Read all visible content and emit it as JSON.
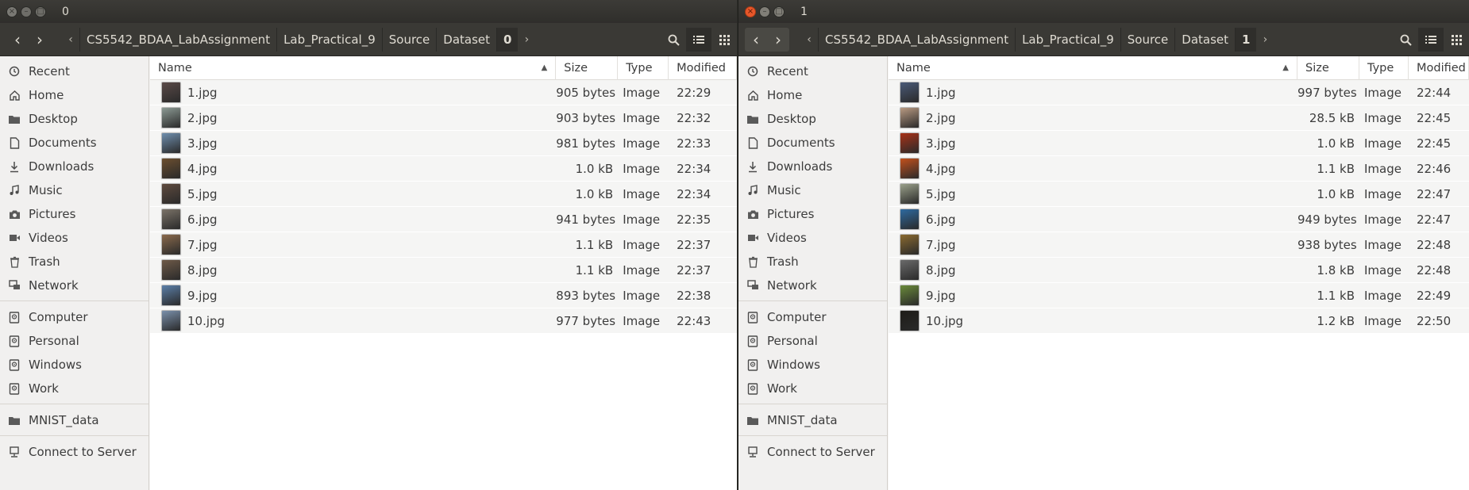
{
  "windows": [
    {
      "title": "0",
      "active": false,
      "breadcrumbs": [
        "CS5542_BDAA_LabAssignment",
        "Lab_Practical_9",
        "Source",
        "Dataset",
        "0"
      ],
      "columns": [
        "Name",
        "Size",
        "Type",
        "Modified"
      ],
      "files": [
        {
          "name": "1.jpg",
          "size": "905 bytes",
          "type": "Image",
          "modified": "22:29",
          "thumb": "#5a4a48"
        },
        {
          "name": "2.jpg",
          "size": "903 bytes",
          "type": "Image",
          "modified": "22:32",
          "thumb": "#8c9a94"
        },
        {
          "name": "3.jpg",
          "size": "981 bytes",
          "type": "Image",
          "modified": "22:33",
          "thumb": "#6f8fae"
        },
        {
          "name": "4.jpg",
          "size": "1.0 kB",
          "type": "Image",
          "modified": "22:34",
          "thumb": "#6b4e2f"
        },
        {
          "name": "5.jpg",
          "size": "1.0 kB",
          "type": "Image",
          "modified": "22:34",
          "thumb": "#5e4a3e"
        },
        {
          "name": "6.jpg",
          "size": "941 bytes",
          "type": "Image",
          "modified": "22:35",
          "thumb": "#7b7368"
        },
        {
          "name": "7.jpg",
          "size": "1.1 kB",
          "type": "Image",
          "modified": "22:37",
          "thumb": "#8a6a4c"
        },
        {
          "name": "8.jpg",
          "size": "1.1 kB",
          "type": "Image",
          "modified": "22:37",
          "thumb": "#6e5a48"
        },
        {
          "name": "9.jpg",
          "size": "893 bytes",
          "type": "Image",
          "modified": "22:38",
          "thumb": "#5b7fa8"
        },
        {
          "name": "10.jpg",
          "size": "977 bytes",
          "type": "Image",
          "modified": "22:43",
          "thumb": "#7a90ab"
        }
      ]
    },
    {
      "title": "1",
      "active": true,
      "breadcrumbs": [
        "CS5542_BDAA_LabAssignment",
        "Lab_Practical_9",
        "Source",
        "Dataset",
        "1"
      ],
      "columns": [
        "Name",
        "Size",
        "Type",
        "Modified"
      ],
      "files": [
        {
          "name": "1.jpg",
          "size": "997 bytes",
          "type": "Image",
          "modified": "22:44",
          "thumb": "#4a5a78"
        },
        {
          "name": "2.jpg",
          "size": "28.5 kB",
          "type": "Image",
          "modified": "22:45",
          "thumb": "#b89a82"
        },
        {
          "name": "3.jpg",
          "size": "1.0 kB",
          "type": "Image",
          "modified": "22:45",
          "thumb": "#a83218"
        },
        {
          "name": "4.jpg",
          "size": "1.1 kB",
          "type": "Image",
          "modified": "22:46",
          "thumb": "#c2501c"
        },
        {
          "name": "5.jpg",
          "size": "1.0 kB",
          "type": "Image",
          "modified": "22:47",
          "thumb": "#9aa08a"
        },
        {
          "name": "6.jpg",
          "size": "949 bytes",
          "type": "Image",
          "modified": "22:47",
          "thumb": "#2e6aa0"
        },
        {
          "name": "7.jpg",
          "size": "938 bytes",
          "type": "Image",
          "modified": "22:48",
          "thumb": "#8a6a30"
        },
        {
          "name": "8.jpg",
          "size": "1.8 kB",
          "type": "Image",
          "modified": "22:48",
          "thumb": "#6a6a6a"
        },
        {
          "name": "9.jpg",
          "size": "1.1 kB",
          "type": "Image",
          "modified": "22:49",
          "thumb": "#6a8a3a"
        },
        {
          "name": "10.jpg",
          "size": "1.2 kB",
          "type": "Image",
          "modified": "22:50",
          "thumb": "#1e1c18"
        }
      ]
    }
  ],
  "sidebar": {
    "places": [
      {
        "label": "Recent",
        "icon": "clock-icon"
      },
      {
        "label": "Home",
        "icon": "home-icon"
      },
      {
        "label": "Desktop",
        "icon": "folder-icon"
      },
      {
        "label": "Documents",
        "icon": "document-icon"
      },
      {
        "label": "Downloads",
        "icon": "download-icon"
      },
      {
        "label": "Music",
        "icon": "music-icon"
      },
      {
        "label": "Pictures",
        "icon": "camera-icon"
      },
      {
        "label": "Videos",
        "icon": "video-icon"
      },
      {
        "label": "Trash",
        "icon": "trash-icon"
      },
      {
        "label": "Network",
        "icon": "network-icon"
      }
    ],
    "devices": [
      {
        "label": "Computer",
        "icon": "drive-icon"
      },
      {
        "label": "Personal",
        "icon": "drive-icon"
      },
      {
        "label": "Windows",
        "icon": "drive-icon"
      },
      {
        "label": "Work",
        "icon": "drive-icon"
      }
    ],
    "bookmarks": [
      {
        "label": "MNIST_data",
        "icon": "folder-icon"
      }
    ],
    "server": {
      "label": "Connect to Server",
      "icon": "server-icon"
    }
  }
}
